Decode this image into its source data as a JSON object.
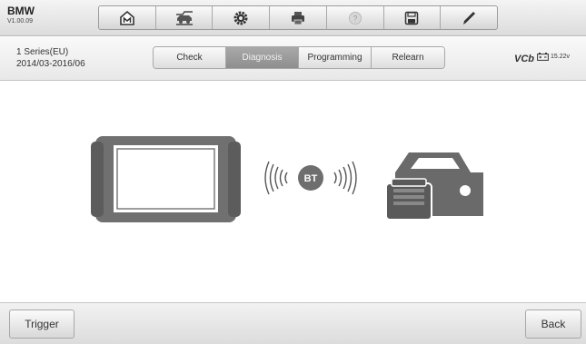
{
  "header": {
    "brand": "BMW",
    "version": "V1.00.09"
  },
  "toolbar": {
    "buttons": [
      {
        "icon": "home-icon"
      },
      {
        "icon": "vehicle-swap-icon"
      },
      {
        "icon": "settings-gear-icon"
      },
      {
        "icon": "printer-icon"
      },
      {
        "icon": "help-icon"
      },
      {
        "icon": "save-icon"
      },
      {
        "icon": "pen-icon"
      }
    ]
  },
  "vehicle": {
    "model": "1 Series(EU)",
    "years": "2014/03-2016/06"
  },
  "tabs": [
    {
      "label": "Check",
      "active": false
    },
    {
      "label": "Diagnosis",
      "active": true
    },
    {
      "label": "Programming",
      "active": false
    },
    {
      "label": "Relearn",
      "active": false
    }
  ],
  "status": {
    "vci_label": "VCb",
    "voltage": "15.22v"
  },
  "connection": {
    "bt_label": "BT"
  },
  "footer": {
    "trigger_label": "Trigger",
    "back_label": "Back"
  },
  "colors": {
    "active_tab": "#999999",
    "icon_gray": "#5a5a5a",
    "bt_circle": "#707070"
  }
}
